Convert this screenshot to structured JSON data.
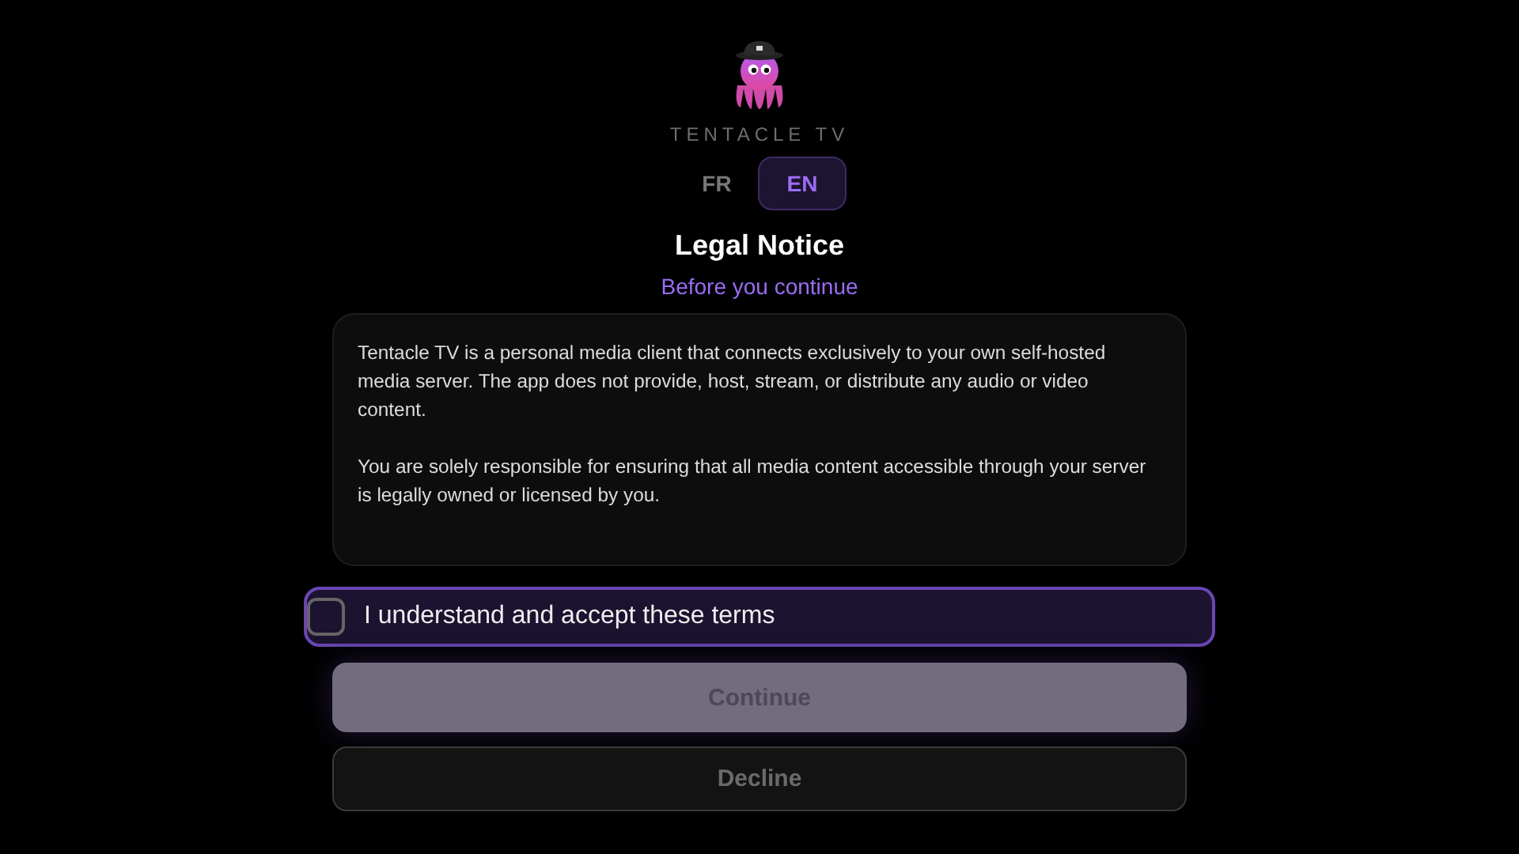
{
  "app_name": "TENTACLE TV",
  "languages": [
    {
      "label": "FR",
      "selected": false
    },
    {
      "label": "EN",
      "selected": true
    }
  ],
  "title": "Legal Notice",
  "subtitle": "Before you continue",
  "notice_paragraphs": [
    "Tentacle TV is a personal media client that connects exclusively to your own self-hosted media server. The app does not provide, host, stream, or distribute any audio or video content.",
    "You are solely responsible for ensuring that all media content accessible through your server is legally owned or licensed by you."
  ],
  "accept": {
    "label": "I understand and accept these terms",
    "checked": false,
    "focused": true
  },
  "buttons": [
    {
      "label": "Continue",
      "kind": "primary",
      "disabled": true
    },
    {
      "label": "Decline",
      "kind": "secondary",
      "disabled": false
    }
  ]
}
